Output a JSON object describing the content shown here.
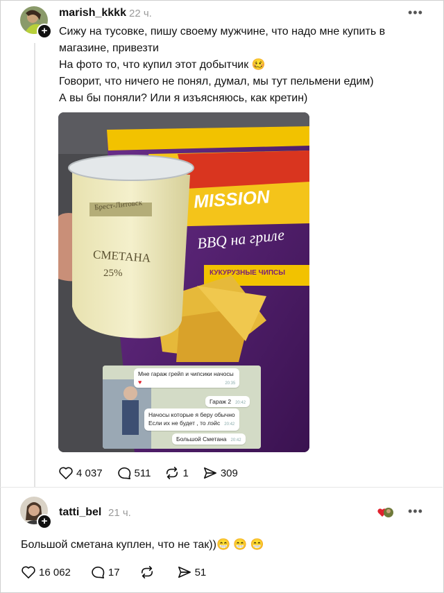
{
  "post": {
    "username": "marish_kkkk",
    "time": "22 ч.",
    "more_label": "•••",
    "lines": [
      "Сижу на тусовке, пишу своему мужчине, что надо мне купить в",
      "магазине, привезти",
      "На фото то, что купил этот добытчик 🥴",
      "Говорит, что ничего не понял, думал, мы тут пельмени едим)",
      "А вы бы поняли? Или я изъясняюсь, как кретин)"
    ],
    "photo": {
      "jar_brand": "Брест-Литовск",
      "jar_label": "СМЕТАНА",
      "jar_percent": "25%",
      "bag_brand": "MISSION",
      "bag_flavor": "BBQ на гриле",
      "bag_type": "КУКУРУЗНЫЕ ЧИПСЫ",
      "chat": [
        {
          "text": "Мне гараж грейп и чипсики начосы",
          "time": "20:35"
        },
        {
          "text": "Гараж 2",
          "time": "20:42"
        },
        {
          "text": "Начосы которые я беру обычно",
          "time": ""
        },
        {
          "text": "Если их не будет , то лэйс",
          "time": "20:42"
        },
        {
          "text": "Большой Сметана",
          "time": "20:42"
        }
      ]
    },
    "stats": {
      "likes": "4 037",
      "comments": "511",
      "reposts": "1",
      "shares": "309"
    }
  },
  "reply": {
    "username": "tatti_bel",
    "time": "21 ч.",
    "more_label": "•••",
    "text": "Большой сметана куплен, что не так))😁 😁 😁",
    "stats": {
      "likes": "16 062",
      "comments": "17",
      "reposts": "",
      "shares": "51"
    }
  },
  "colors": {
    "text": "#111111",
    "muted": "#9a9a9a",
    "line": "#e3e3e3"
  }
}
